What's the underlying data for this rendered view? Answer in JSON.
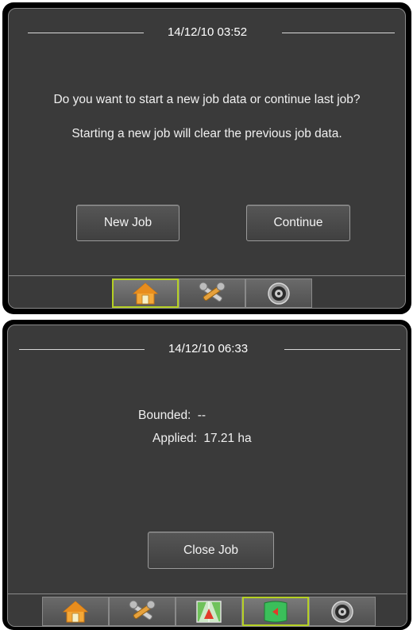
{
  "screen1": {
    "datetime": "14/12/10 03:52",
    "question": "Do you want to start a new job data or continue last job?",
    "warning": "Starting a new job will clear the previous job data.",
    "new_job_label": "New Job",
    "continue_label": "Continue",
    "tabs": [
      "home-icon",
      "tools-icon",
      "gauge-icon"
    ],
    "active_tab": "home-icon"
  },
  "screen2": {
    "datetime": "14/12/10 06:33",
    "bounded_label": "Bounded:",
    "bounded_value": "--",
    "applied_label": "Applied:",
    "applied_value": "17.21 ha",
    "close_job_label": "Close Job",
    "tabs": [
      "home-icon",
      "tools-icon",
      "guidance-icon",
      "job-icon",
      "gauge-icon"
    ],
    "active_tab": "job-icon"
  },
  "colors": {
    "screen_bg": "#3a3a3a",
    "active_tab_border": "#b5d023",
    "text": "#ffffff"
  }
}
